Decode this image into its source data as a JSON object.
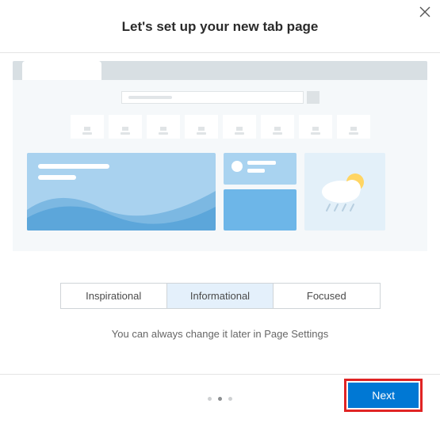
{
  "close_icon": "close-icon",
  "title": "Let's set up your new tab page",
  "options": [
    {
      "label": "Inspirational",
      "selected": false
    },
    {
      "label": "Informational",
      "selected": true
    },
    {
      "label": "Focused",
      "selected": false
    }
  ],
  "hint": "You can always change it later in Page Settings",
  "pager": {
    "count": 3,
    "active": 1
  },
  "next_label": "Next"
}
